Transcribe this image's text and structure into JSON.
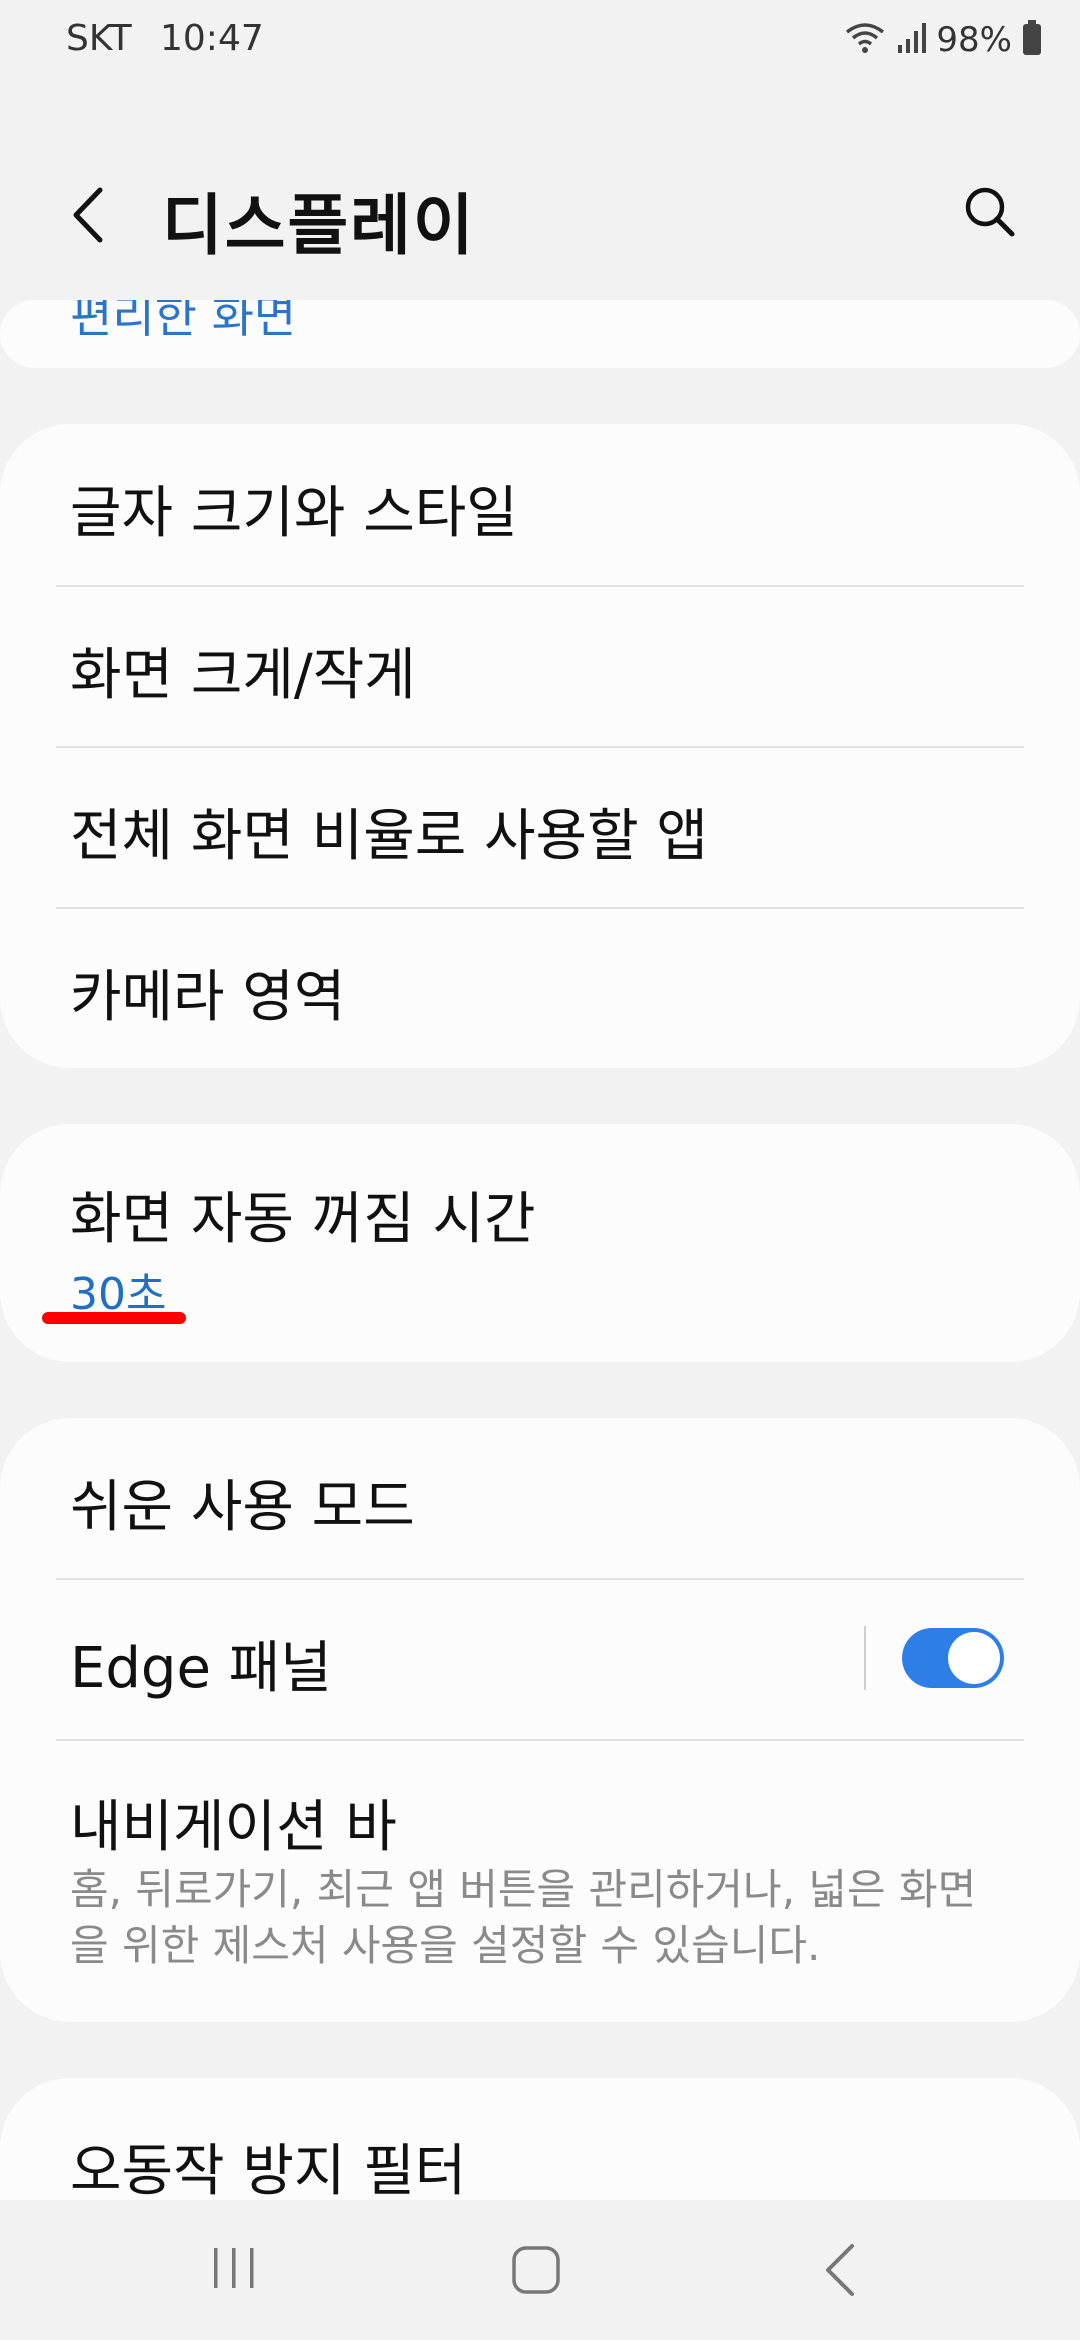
{
  "status_bar": {
    "carrier": "SKT",
    "time": "10:47",
    "battery": "98%",
    "icons": [
      "wifi-icon",
      "signal-icon",
      "battery-icon"
    ]
  },
  "app_bar": {
    "title": "디스플레이",
    "back_icon": "back-arrow-icon",
    "search_icon": "search-icon"
  },
  "top_card": {
    "partial_label": "편리한 화면"
  },
  "group1": {
    "items": [
      {
        "label": "글자 크기와 스타일"
      },
      {
        "label": "화면 크게/작게"
      },
      {
        "label": "전체 화면 비율로 사용할 앱"
      },
      {
        "label": "카메라 영역"
      }
    ]
  },
  "screen_timeout": {
    "label": "화면 자동 꺼짐 시간",
    "value": "30초"
  },
  "group3": {
    "easy_mode": {
      "label": "쉬운 사용 모드"
    },
    "edge_panel": {
      "label": "Edge 패널",
      "toggle_on": true
    },
    "navigation_bar": {
      "label": "내비게이션 바",
      "description": "홈, 뒤로가기, 최근 앱 버튼을 관리하거나, 넓은 화면을 위한 제스처 사용을 설정할 수 있습니다."
    }
  },
  "bottom_card": {
    "label": "오동작 방지 필터"
  },
  "nav_bar": {
    "icons": [
      "recent-apps-icon",
      "home-icon",
      "back-icon"
    ]
  },
  "colors": {
    "accent_blue": "#1f6fc4",
    "toggle_blue": "#2d7ee6",
    "annotation_red": "#ff0000",
    "background": "#f2f2f2",
    "card": "#fcfcfc"
  }
}
